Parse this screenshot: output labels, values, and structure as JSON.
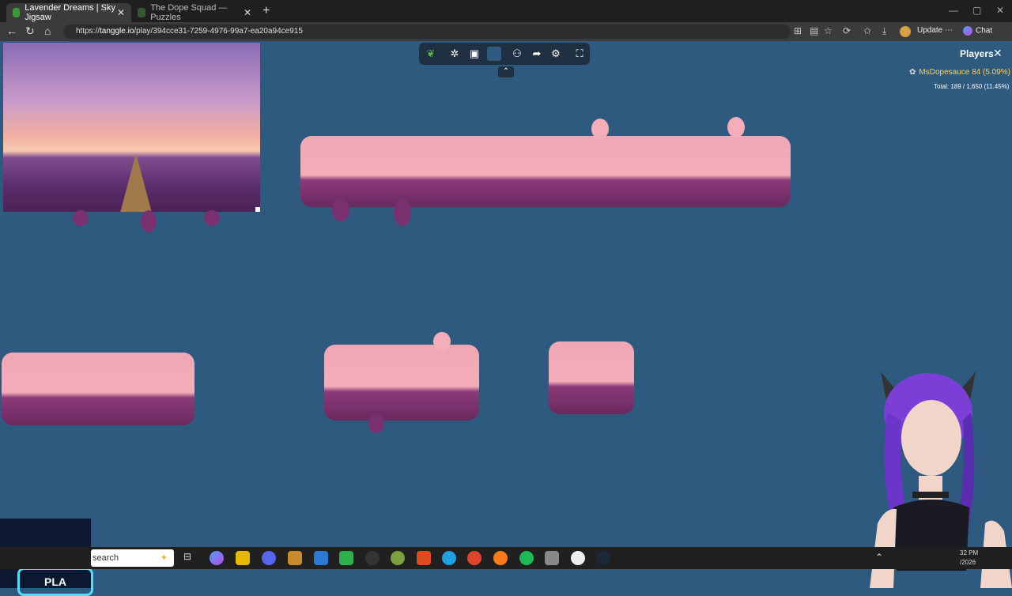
{
  "browser": {
    "tabs": [
      {
        "title": "Lavender Dreams | Sky Jigsaw",
        "active": true
      },
      {
        "title": "The Dope Squad — Puzzles",
        "active": false
      }
    ],
    "url": {
      "prefix": "https://",
      "host": "tanggle.io",
      "path": "/play/394cce31-7259-4976-99a7-ea20a94ce915"
    },
    "update_label": "Update",
    "chat_label": "Chat"
  },
  "game": {
    "players_title": "Players",
    "player": {
      "name": "MsDopesauce",
      "score": "84 (5.09%)"
    },
    "total": "Total: 189 / 1,650 (11.45%)"
  },
  "overlay": {
    "play_label": "PLA"
  },
  "taskbar": {
    "search_placeholder": "search",
    "clock_time": "32 PM",
    "clock_date": "/2026"
  },
  "colors": {
    "game_bg": "#2e5a80",
    "piece_pink": "#f3aeb9",
    "lavender": "#7a3170"
  }
}
